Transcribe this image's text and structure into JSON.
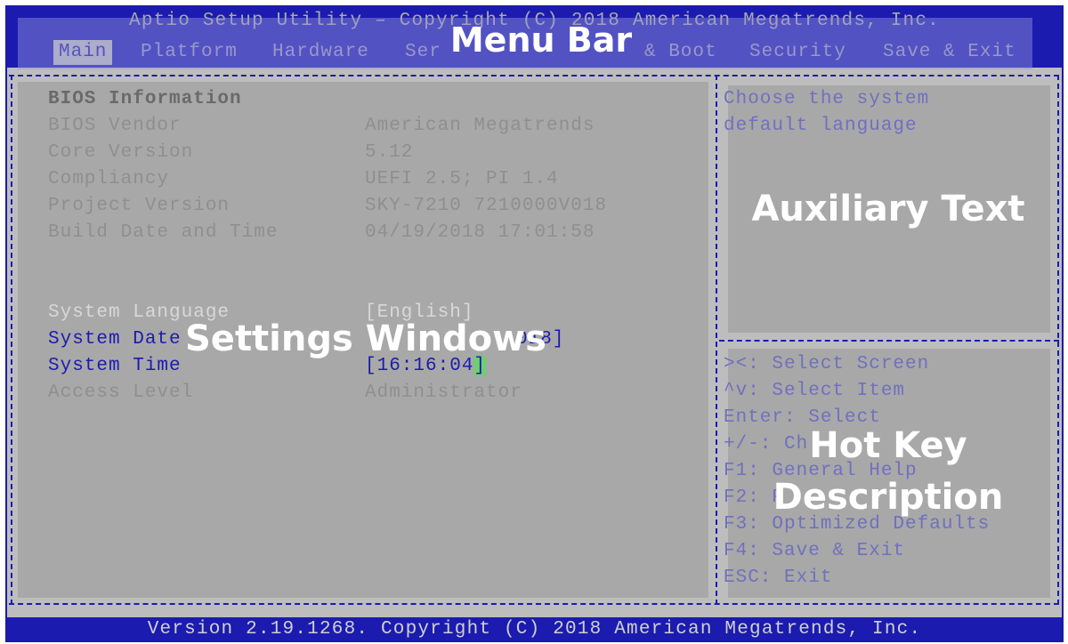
{
  "title_bar": "Aptio Setup Utility – Copyright (C) 2018 American Megatrends, Inc.",
  "menu": [
    {
      "label": "Main",
      "active": true
    },
    {
      "label": "Platform",
      "active": false
    },
    {
      "label": "Hardware",
      "active": false
    },
    {
      "label": "Ser",
      "active": false
    },
    {
      "label": "& Boot",
      "active": false
    },
    {
      "label": "Security",
      "active": false
    },
    {
      "label": "Save & Exit",
      "active": false
    }
  ],
  "bios_info": {
    "heading": "BIOS Information",
    "rows": [
      {
        "label": "BIOS Vendor",
        "value": "American Megatrends"
      },
      {
        "label": "Core Version",
        "value": "5.12"
      },
      {
        "label": "Compliancy",
        "value": "UEFI 2.5; PI 1.4"
      },
      {
        "label": "Project Version",
        "value": "SKY-7210 7210000V018"
      },
      {
        "label": "Build Date and Time",
        "value": "04/19/2018 17:01:58"
      }
    ]
  },
  "settings": [
    {
      "label": "System Language",
      "value": "[English]"
    },
    {
      "label": "System Date",
      "value": "018]"
    },
    {
      "label": "System Time",
      "value": "[16:16:04",
      "cursor": "]"
    },
    {
      "label": "Access Level",
      "value": "Administrator"
    }
  ],
  "aux_text": [
    "Choose the system",
    "default language"
  ],
  "hotkeys": [
    "><: Select Screen",
    "^v: Select Item",
    "Enter: Select",
    "+/-: Ch",
    "F1: General Help",
    "F2: P",
    "F3: Optimized Defaults",
    "F4: Save & Exit",
    "ESC: Exit"
  ],
  "overlays": {
    "menu_bar": "Menu Bar",
    "settings_windows": "Settings Windows",
    "auxiliary_text": "Auxiliary Text",
    "hot_key_line1": "Hot Key",
    "hot_key_line2": "Description"
  },
  "version_bar": "Version 2.19.1268. Copyright (C) 2018 American Megatrends, Inc.",
  "colors": {
    "bios_blue": "#1b1bb0",
    "panel_gray": "#a8a8a8",
    "highlight_green": "#6fcf6f"
  }
}
